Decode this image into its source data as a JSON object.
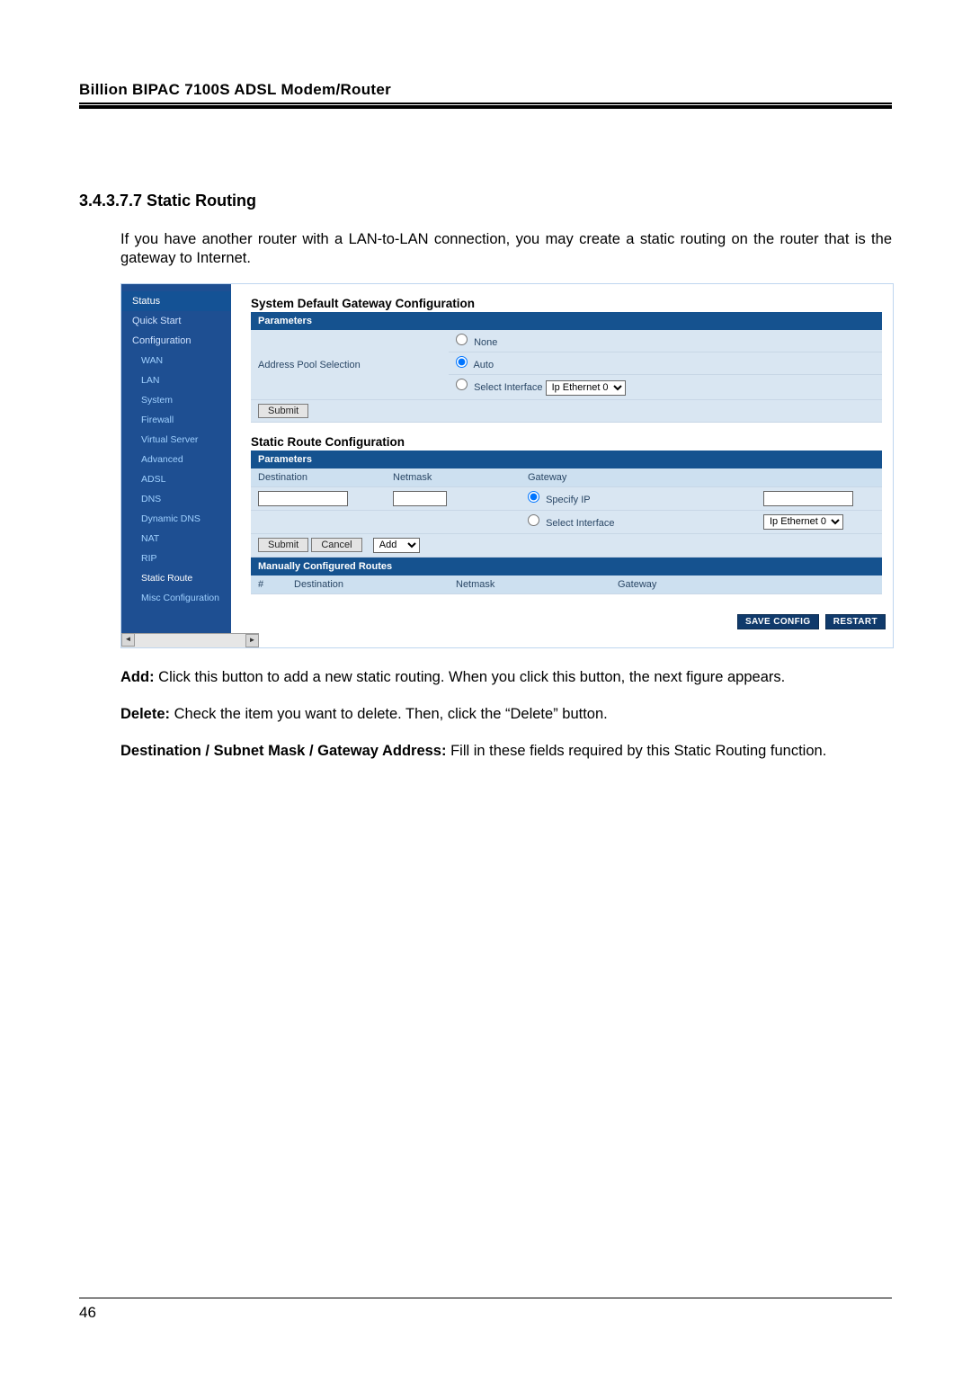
{
  "header": {
    "title": "Billion BIPAC 7100S ADSL Modem/Router"
  },
  "section": {
    "heading": "3.4.3.7.7 Static Routing"
  },
  "paragraphs": {
    "intro": "If you have another router with a LAN-to-LAN connection, you may create a static routing on the router that is the gateway to Internet.",
    "add_label": "Add:",
    "add_text": " Click this button to add a new static routing. When you click this button, the next figure appears.",
    "delete_label": "Delete:",
    "delete_text": " Check the item you want to delete. Then, click the “Delete” button.",
    "dest_label": "Destination / Subnet Mask / Gateway Address:",
    "dest_text": " Fill in these fields required by this Static Routing function."
  },
  "sidebar": {
    "items": [
      "Status",
      "Quick Start",
      "Configuration",
      "WAN",
      "LAN",
      "System",
      "Firewall",
      "Virtual Server",
      "Advanced",
      "ADSL",
      "DNS",
      "Dynamic DNS",
      "NAT",
      "RIP",
      "Static Route",
      "Misc Configuration"
    ]
  },
  "panel1": {
    "title": "System Default Gateway Configuration",
    "parameters_label": "Parameters",
    "pool_selection_label": "Address Pool Selection",
    "none": "None",
    "auto": "Auto",
    "select_interface": "Select Interface",
    "iface_option": "Ip Ethernet 0",
    "submit": "Submit"
  },
  "panel2": {
    "title": "Static Route Configuration",
    "parameters_label": "Parameters",
    "destination": "Destination",
    "netmask": "Netmask",
    "gateway": "Gateway",
    "specify_ip": "Specify IP",
    "select_interface": "Select Interface",
    "iface_option": "Ip Ethernet 0",
    "submit": "Submit",
    "cancel": "Cancel",
    "add_option": "Add",
    "mcr_label": "Manually Configured Routes",
    "col_num": "#",
    "col_dest": "Destination",
    "col_netmask": "Netmask",
    "col_gateway": "Gateway"
  },
  "buttons": {
    "save": "SAVE CONFIG",
    "restart": "RESTART"
  },
  "footer": {
    "page": "46"
  }
}
